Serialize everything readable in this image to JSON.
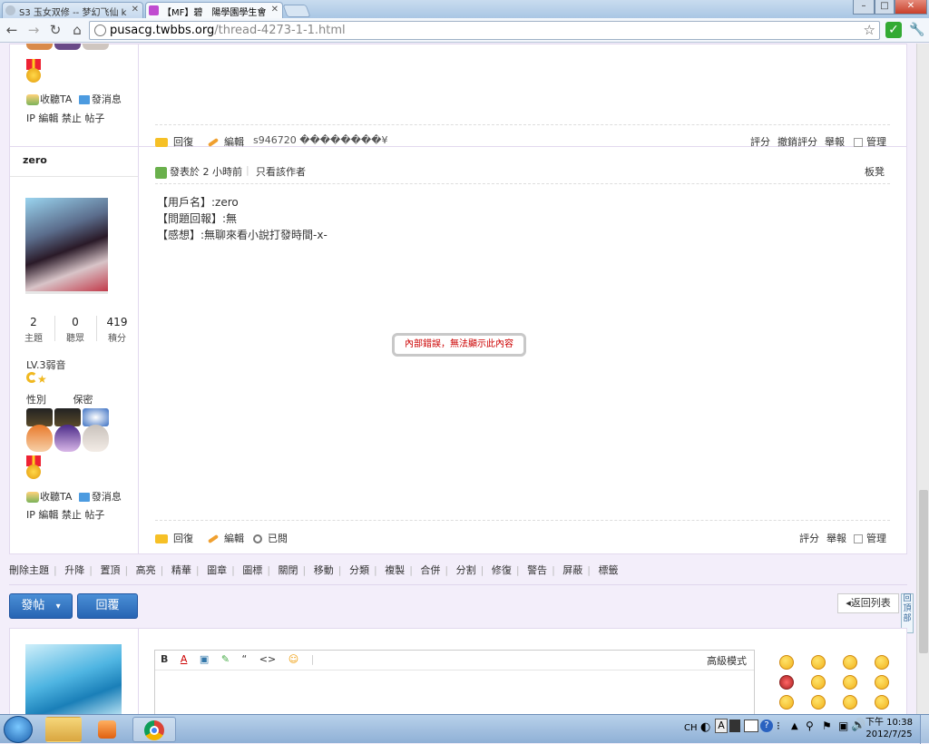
{
  "browser": {
    "tabs": [
      {
        "title": "S3 玉女双修 -- 梦幻飞仙 k",
        "active": false
      },
      {
        "title": "【MF】碧　陽學園學生會",
        "active": true
      }
    ],
    "url_host": "pusacg.twbbs.org",
    "url_path": "/thread-4273-1-1.html",
    "window_controls": {
      "minimize": "–",
      "maximize": "□",
      "close": "✕"
    }
  },
  "prev_post": {
    "follow": "收聽TA",
    "message": "發消息",
    "admin_links": "IP 編輯 禁止 帖子",
    "reply": "回復",
    "edit": "編輯",
    "garbled_text": "s946720 ��������¥",
    "rate": "評分",
    "undo_rate": "撤銷評分",
    "report": "舉報",
    "manage": "管理"
  },
  "post": {
    "username": "zero",
    "posted_time": "發表於 2 小時前",
    "only_author": "只看該作者",
    "floor": "板凳",
    "stats": [
      {
        "value": "2",
        "label": "主題"
      },
      {
        "value": "0",
        "label": "聽眾"
      },
      {
        "value": "419",
        "label": "積分"
      }
    ],
    "level": "LV.3弱音",
    "gender_label": "性別",
    "gender_value": "保密",
    "follow": "收聽TA",
    "message": "發消息",
    "admin_links": "IP 編輯 禁止 帖子",
    "body_lines": [
      "【用戶名】:zero",
      "【問題回報】:無",
      "【感想】:無聊來看小說打發時間-x-"
    ],
    "error_message": "內部錯誤，無法顯示此內容",
    "reply": "回復",
    "edit": "編輯",
    "read": "已閱",
    "rate": "評分",
    "report": "舉報",
    "manage": "管理"
  },
  "mod_actions": [
    "刪除主題",
    "升降",
    "置頂",
    "高亮",
    "精華",
    "圖章",
    "圖標",
    "關閉",
    "移動",
    "分類",
    "複製",
    "合併",
    "分割",
    "修復",
    "警告",
    "屏蔽",
    "標籤"
  ],
  "buttons": {
    "new_post": "發帖",
    "new_post_arrow": "▾",
    "reply": "回覆",
    "back_to_list": "返回列表",
    "back_to_top": "回頂部"
  },
  "editor": {
    "tools": [
      "B",
      "A",
      "▣",
      "✎",
      "“",
      "<>",
      "☺"
    ],
    "advanced_mode": "高級模式"
  },
  "taskbar": {
    "ime": "CH",
    "clock_period": "下午 10:38",
    "clock_date": "2012/7/25"
  },
  "colors": {
    "page_bg": "#f3eefa",
    "accent_blue": "#2764b3",
    "error_red": "#cc0000"
  }
}
